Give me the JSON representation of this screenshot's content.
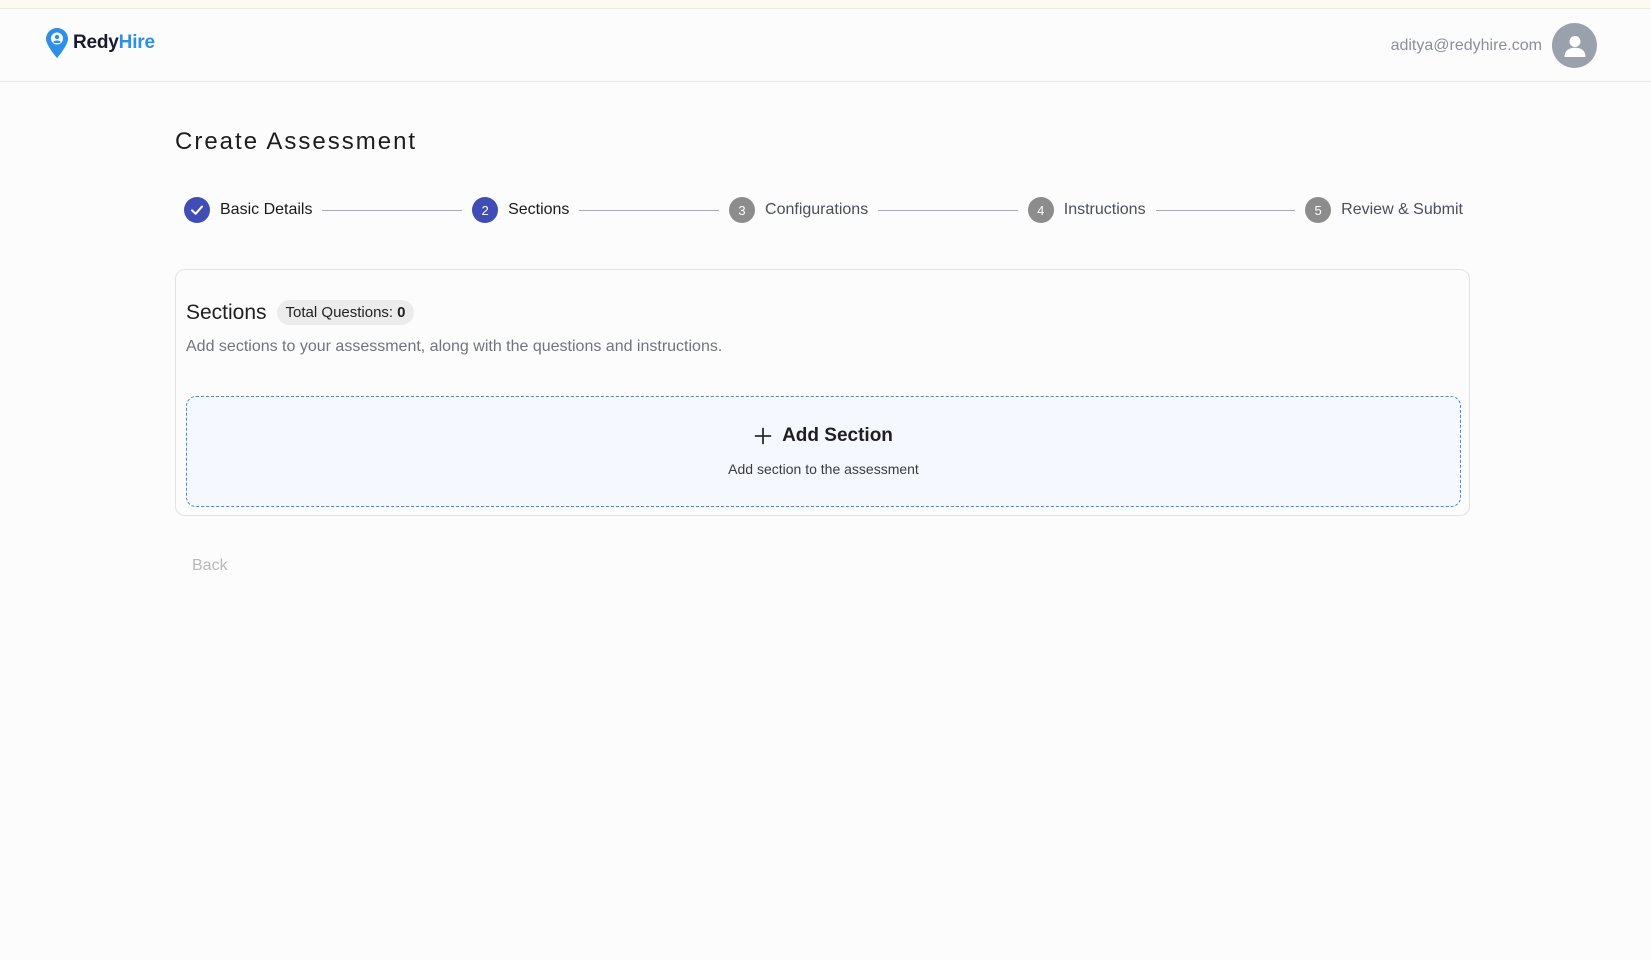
{
  "colors": {
    "primary": "#3f4db5",
    "brand_blue": "#2e8fe6",
    "pending_step": "#8c8c8c",
    "dashed_border": "#3d8ed4",
    "dropzone_bg": "#f5f8ff"
  },
  "header": {
    "logo": {
      "icon": "location-pin-logo-icon",
      "part1": "Redy",
      "part2": "Hire"
    },
    "user": {
      "email": "aditya@redyhire.com",
      "avatar_icon": "user-avatar-icon"
    }
  },
  "page": {
    "title": "Create Assessment"
  },
  "stepper": {
    "steps": [
      {
        "number": "1",
        "label": "Basic Details",
        "status": "completed",
        "icon": "check-icon"
      },
      {
        "number": "2",
        "label": "Sections",
        "status": "active"
      },
      {
        "number": "3",
        "label": "Configurations",
        "status": "pending"
      },
      {
        "number": "4",
        "label": "Instructions",
        "status": "pending"
      },
      {
        "number": "5",
        "label": "Review & Submit",
        "status": "pending"
      }
    ]
  },
  "sections_card": {
    "title": "Sections",
    "badge_label": "Total Questions:",
    "badge_value": "0",
    "description": "Add sections to your assessment, along with the questions and instructions.",
    "add_section": {
      "icon": "plus-icon",
      "title": "Add Section",
      "subtitle": "Add section to the assessment"
    }
  },
  "footer": {
    "back_label": "Back"
  }
}
